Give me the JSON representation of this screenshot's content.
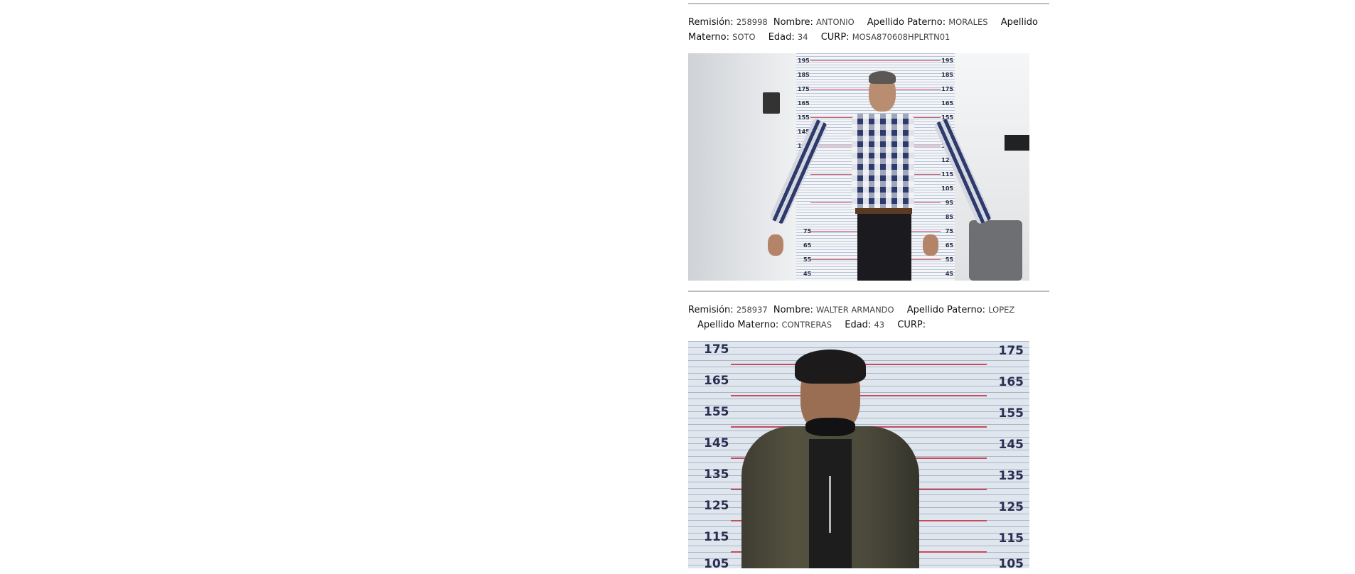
{
  "records": [
    {
      "remision_label": "Remisión:",
      "remision": "258998",
      "nombre_label": "Nombre:",
      "nombre": "ANTONIO",
      "apellido_paterno_label": "Apellido Paterno:",
      "apellido_paterno": "MORALES",
      "apellido_materno_label_1": "Apellido",
      "apellido_materno_label_2": "Materno:",
      "apellido_materno": "SOTO",
      "edad_label": "Edad:",
      "edad": "34",
      "curp_label": "CURP:",
      "curp": "MOSA870608HPLRTN01",
      "photo": {
        "ruler_left": [
          "195",
          "185",
          "175",
          "165",
          "155",
          "145",
          "135",
          "12"
        ],
        "ruler_right": [
          "195",
          "185",
          "175",
          "165",
          "155",
          "145",
          "135",
          "125",
          "115",
          "105",
          "95",
          "85",
          "75",
          "65",
          "55",
          "45"
        ],
        "ruler_left_low": [
          "75",
          "65",
          "55",
          "45"
        ]
      }
    },
    {
      "remision_label": "Remisión:",
      "remision": "258937",
      "nombre_label": "Nombre:",
      "nombre": "WALTER ARMANDO",
      "apellido_paterno_label": "Apellido Paterno:",
      "apellido_paterno": "LOPEZ",
      "apellido_materno_label": "Apellido Materno:",
      "apellido_materno": "CONTRERAS",
      "edad_label": "Edad:",
      "edad": "43",
      "curp_label": "CURP:",
      "curp": "",
      "photo": {
        "ruler_marks": [
          "175",
          "165",
          "155",
          "145",
          "135",
          "125",
          "115",
          "105"
        ]
      }
    }
  ]
}
